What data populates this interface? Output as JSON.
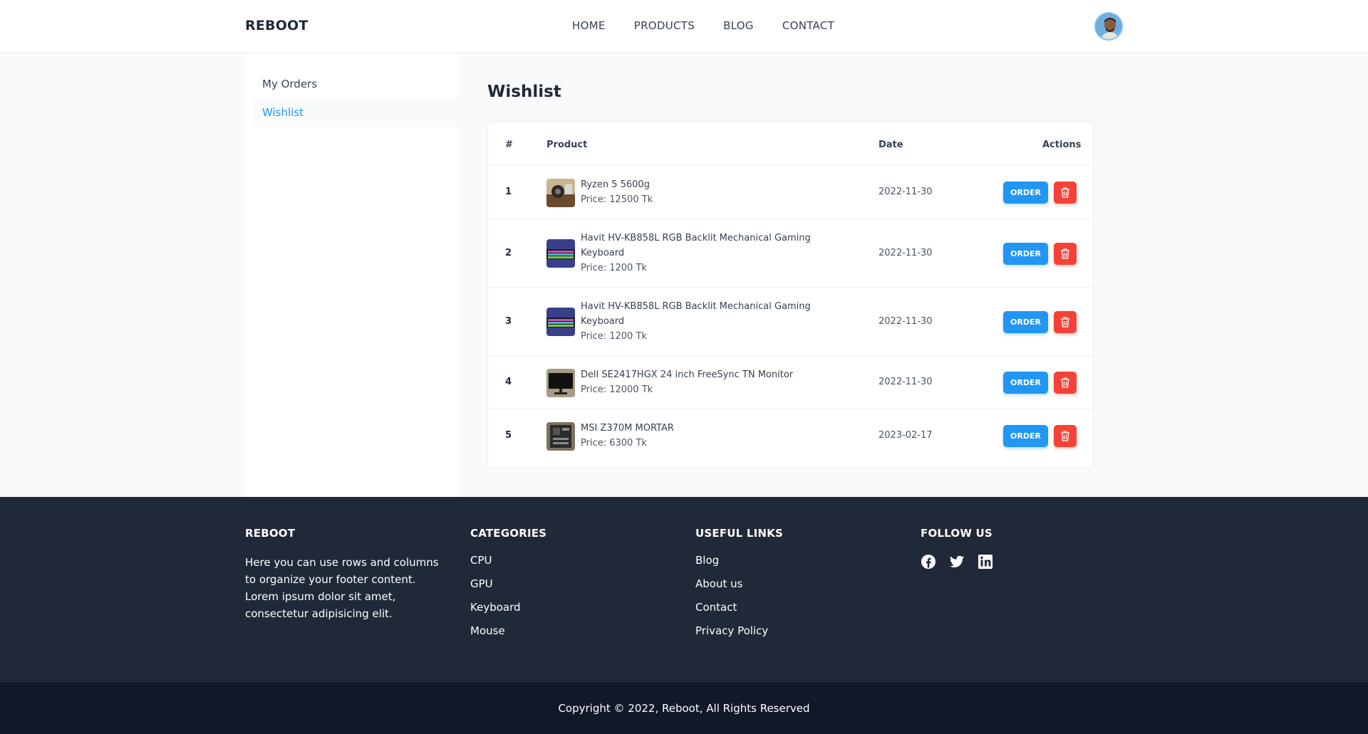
{
  "header": {
    "brand": "REBOOT",
    "nav": [
      "HOME",
      "PRODUCTS",
      "BLOG",
      "CONTACT"
    ]
  },
  "sidebar": {
    "items": [
      {
        "label": "My Orders",
        "active": false
      },
      {
        "label": "Wishlist",
        "active": true
      }
    ]
  },
  "main": {
    "title": "Wishlist",
    "table": {
      "headers": [
        "#",
        "Product",
        "Date",
        "Actions"
      ],
      "rows": [
        {
          "num": "1",
          "name": "Ryzen 5 5600g",
          "price": "Price: 12500 Tk",
          "date": "2022-11-30",
          "order_label": "ORDER"
        },
        {
          "num": "2",
          "name": "Havit HV-KB858L RGB Backlit Mechanical Gaming Keyboard",
          "price": "Price: 1200 Tk",
          "date": "2022-11-30",
          "order_label": "ORDER"
        },
        {
          "num": "3",
          "name": "Havit HV-KB858L RGB Backlit Mechanical Gaming Keyboard",
          "price": "Price: 1200 Tk",
          "date": "2022-11-30",
          "order_label": "ORDER"
        },
        {
          "num": "4",
          "name": "Dell SE2417HGX 24 inch FreeSync TN Monitor",
          "price": "Price: 12000 Tk",
          "date": "2022-11-30",
          "order_label": "ORDER"
        },
        {
          "num": "5",
          "name": "MSI Z370M MORTAR",
          "price": "Price: 6300 Tk",
          "date": "2023-02-17",
          "order_label": "ORDER"
        }
      ]
    }
  },
  "footer": {
    "about": {
      "heading": "REBOOT",
      "text": "Here you can use rows and columns to organize your footer content. Lorem ipsum dolor sit amet, consectetur adipisicing elit."
    },
    "categories": {
      "heading": "CATEGORIES",
      "links": [
        "CPU",
        "GPU",
        "Keyboard",
        "Mouse"
      ]
    },
    "useful_links": {
      "heading": "USEFUL LINKS",
      "links": [
        "Blog",
        "About us",
        "Contact",
        "Privacy Policy"
      ]
    },
    "follow": {
      "heading": "FOLLOW US",
      "icons": [
        "facebook-icon",
        "twitter-icon",
        "linkedin-icon"
      ]
    },
    "copyright": "Copyright © 2022, Reboot, All Rights Reserved"
  },
  "colors": {
    "accent": "#2196f3",
    "danger": "#f44336",
    "footer_bg": "#1f2937",
    "copyright_bg": "#111827"
  }
}
